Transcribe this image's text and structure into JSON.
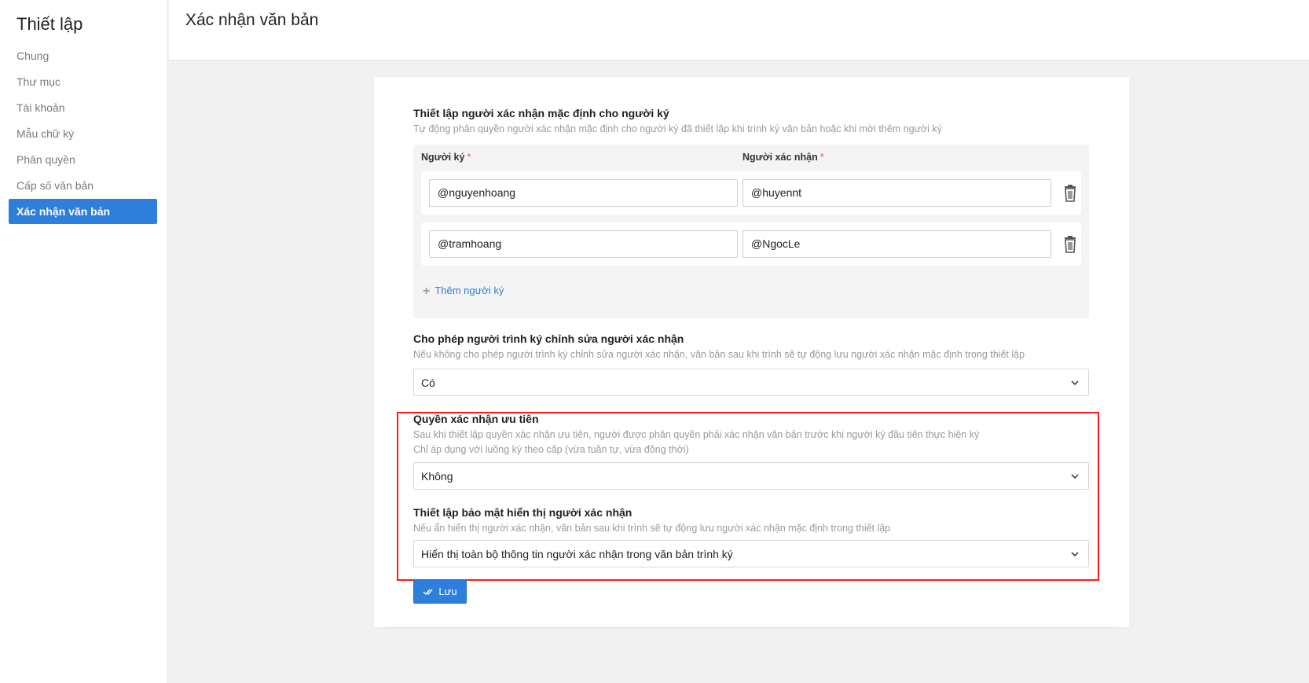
{
  "sidebar": {
    "title": "Thiết lập",
    "items": [
      {
        "label": "Chung"
      },
      {
        "label": "Thư mục"
      },
      {
        "label": "Tài khoản"
      },
      {
        "label": "Mẫu chữ ký"
      },
      {
        "label": "Phân quyền"
      },
      {
        "label": "Cấp số văn bản"
      },
      {
        "label": "Xác nhận văn bản",
        "active": true
      }
    ]
  },
  "header": {
    "title": "Xác nhận văn bản"
  },
  "default_confirmer": {
    "title": "Thiết lập người xác nhận mặc định cho người ký",
    "description": "Tự động phân quyền người xác nhận mặc định cho người ký đã thiết lập khi trình ký văn bản hoặc khi mời thêm người ký",
    "columns": {
      "signer": "Người ký",
      "confirmer": "Người xác nhận",
      "required_mark": "*"
    },
    "rows": [
      {
        "signer": "@nguyenhoang",
        "confirmer": "@huyennt"
      },
      {
        "signer": "@tramhoang",
        "confirmer": "@NgocLe"
      }
    ],
    "add_label": "Thêm người ký"
  },
  "allow_edit": {
    "title": "Cho phép người trình ký chỉnh sửa người xác nhận",
    "description": "Nếu không cho phép người trình ký chỉnh sửa người xác nhận, văn bản sau khi trình sẽ tự động lưu người xác nhận mặc định trong thiết lập",
    "selected": "Có"
  },
  "priority": {
    "title": "Quyền xác nhận ưu tiên",
    "description_1": "Sau khi thiết lập quyền xác nhận ưu tiên, người được phân quyền phải xác nhận văn bản trước khi người ký đầu tiên thực hiện ký",
    "description_2": "Chỉ áp dụng với luồng ký theo cấp (vừa tuần tự, vừa đồng thời)",
    "selected": "Không"
  },
  "privacy": {
    "title": "Thiết lập bảo mật hiển thị người xác nhận",
    "description": "Nếu ẩn hiển thị người xác nhận, văn bản sau khi trình sẽ tự động lưu người xác nhận mặc định trong thiết lập",
    "selected": "Hiển thị toàn bộ thông tin người xác nhận trong văn bản trình ký"
  },
  "save_label": "Lưu",
  "colors": {
    "accent": "#2e7fdb",
    "highlight": "#ff1a1a",
    "required": "#e05050"
  }
}
